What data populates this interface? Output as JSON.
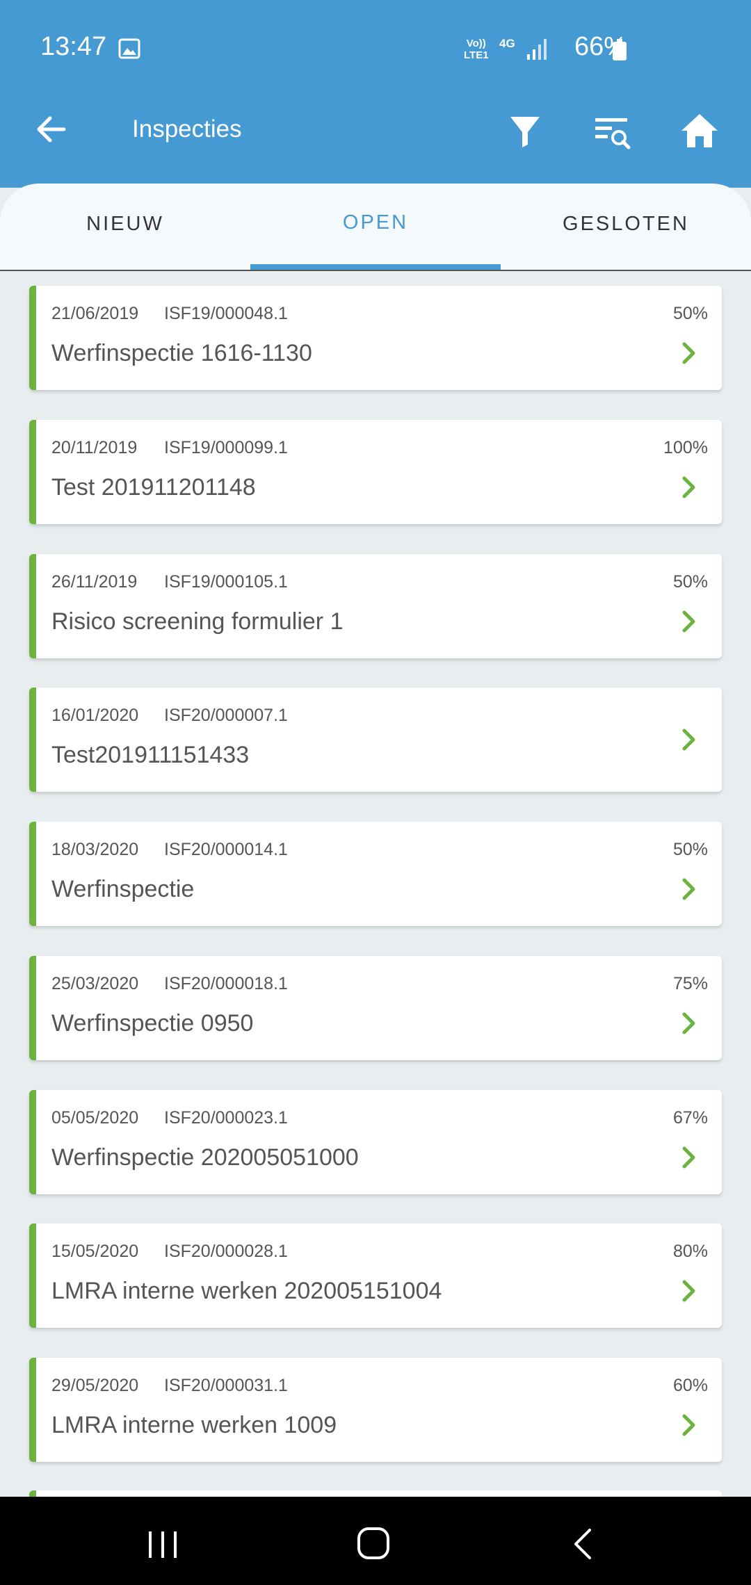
{
  "status_bar": {
    "time": "13:47",
    "network_top": "Vo))",
    "network_bottom": "LTE1",
    "network_type": "4G",
    "battery": "66%"
  },
  "header": {
    "title": "Inspecties"
  },
  "tabs": [
    {
      "label": "NIEUW",
      "active": false
    },
    {
      "label": "OPEN",
      "active": true
    },
    {
      "label": "GESLOTEN",
      "active": false
    }
  ],
  "inspections": [
    {
      "date": "21/06/2019",
      "code": "ISF19/000048.1",
      "progress": "50%",
      "title": "Werfinspectie 1616-1130"
    },
    {
      "date": "20/11/2019",
      "code": "ISF19/000099.1",
      "progress": "100%",
      "title": "Test 201911201148"
    },
    {
      "date": "26/11/2019",
      "code": "ISF19/000105.1",
      "progress": "50%",
      "title": "Risico screening formulier 1"
    },
    {
      "date": "16/01/2020",
      "code": "ISF20/000007.1",
      "progress": "",
      "title": "Test201911151433"
    },
    {
      "date": "18/03/2020",
      "code": "ISF20/000014.1",
      "progress": "50%",
      "title": "Werfinspectie"
    },
    {
      "date": "25/03/2020",
      "code": "ISF20/000018.1",
      "progress": "75%",
      "title": "Werfinspectie 0950"
    },
    {
      "date": "05/05/2020",
      "code": "ISF20/000023.1",
      "progress": "67%",
      "title": "Werfinspectie 202005051000"
    },
    {
      "date": "15/05/2020",
      "code": "ISF20/000028.1",
      "progress": "80%",
      "title": "LMRA interne werken 202005151004"
    },
    {
      "date": "29/05/2020",
      "code": "ISF20/000031.1",
      "progress": "60%",
      "title": "LMRA interne werken 1009"
    }
  ],
  "colors": {
    "header_bg": "#469ad4",
    "accent_green": "#6cb23e",
    "list_bg": "#e8eef0"
  }
}
